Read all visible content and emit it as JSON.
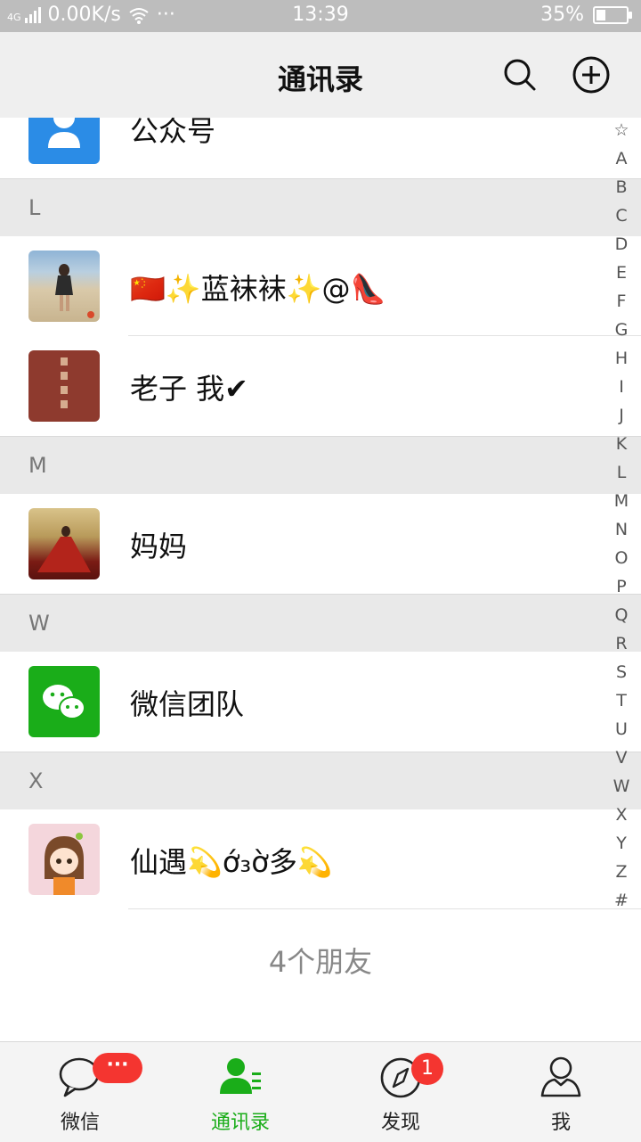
{
  "status_bar": {
    "network": "4G",
    "speed": "0.00K/s",
    "more": "···",
    "time": "13:39",
    "battery": "35%"
  },
  "header": {
    "title": "通讯录"
  },
  "list": {
    "partial_row": {
      "name": "公众号"
    },
    "sections": [
      {
        "letter": "L",
        "contacts": [
          {
            "name": "🇨🇳✨蓝袜袜✨@👠"
          },
          {
            "name": "老子 我✔"
          }
        ]
      },
      {
        "letter": "M",
        "contacts": [
          {
            "name": "妈妈"
          }
        ]
      },
      {
        "letter": "W",
        "contacts": [
          {
            "name": "微信团队"
          }
        ]
      },
      {
        "letter": "X",
        "contacts": [
          {
            "name": "仙遇💫ớ₃ờ多💫"
          }
        ]
      }
    ],
    "footer": "4个朋友"
  },
  "index": [
    "☆",
    "A",
    "B",
    "C",
    "D",
    "E",
    "F",
    "G",
    "H",
    "I",
    "J",
    "K",
    "L",
    "M",
    "N",
    "O",
    "P",
    "Q",
    "R",
    "S",
    "T",
    "U",
    "V",
    "W",
    "X",
    "Y",
    "Z",
    "#"
  ],
  "tabs": [
    {
      "label": "微信",
      "badge": "···"
    },
    {
      "label": "通讯录"
    },
    {
      "label": "发现",
      "badge": "1"
    },
    {
      "label": "我"
    }
  ],
  "colors": {
    "accent": "#1aad19",
    "badge": "#f43530",
    "header_bg": "#efefef",
    "section_bg": "#e9e9e9"
  }
}
